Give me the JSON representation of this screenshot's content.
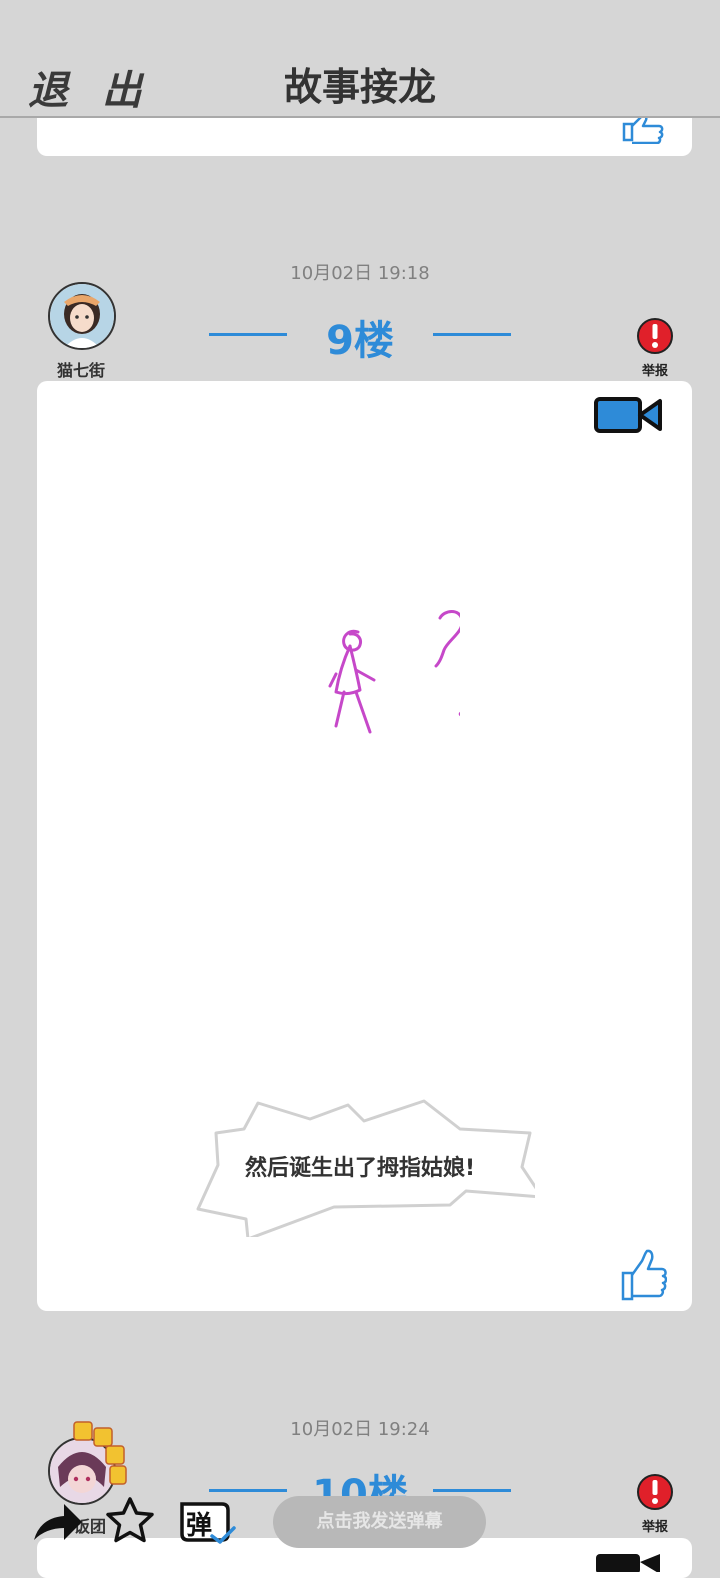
{
  "header": {
    "exit_label": "退 出",
    "title": "故事接龙"
  },
  "posts": [
    {
      "timestamp": "10月02日  19:18",
      "user": "猫七街",
      "floor": "9楼",
      "report_label": "举报",
      "caption": "然后诞生出了拇指姑娘!"
    },
    {
      "timestamp": "10月02日  19:24",
      "user": "饭团",
      "floor": "10楼",
      "report_label": "举报"
    }
  ],
  "bottom_bar": {
    "danmaku_placeholder": "点击我发送弹幕",
    "danmaku_icon_char": "弹"
  },
  "icons": [
    "like-icon",
    "video-icon",
    "alert-icon",
    "share-icon",
    "star-icon",
    "danmaku-icon"
  ],
  "colors": {
    "accent": "#2e8bd8",
    "report": "#e0202a",
    "drawing": "#c648c9",
    "background": "#d6d6d6"
  }
}
